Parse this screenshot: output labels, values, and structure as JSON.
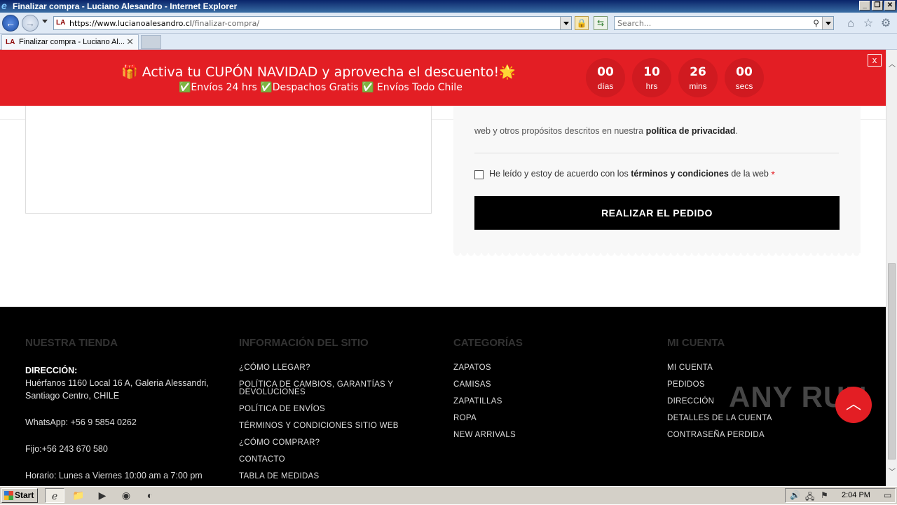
{
  "window": {
    "title": "Finalizar compra - Luciano Alesandro - Internet Explorer",
    "controls": [
      "_",
      "❐",
      "✕"
    ]
  },
  "browser": {
    "url_host": "https://www.lucianoalesandro.cl",
    "url_path": "/finalizar-compra/",
    "search_placeholder": "Search...",
    "tab_title": "Finalizar compra - Luciano Al...",
    "site_icon": "LA"
  },
  "promo": {
    "headline": "🎁 Activa tu CUPÓN NAVIDAD y aprovecha el descuento!🌟",
    "sub": "✅Envíos 24 hrs ✅Despachos Gratis ✅ Envíos Todo Chile",
    "close": "x",
    "countdown": [
      {
        "num": "00",
        "unit": "días"
      },
      {
        "num": "10",
        "unit": "hrs"
      },
      {
        "num": "26",
        "unit": "mins"
      },
      {
        "num": "00",
        "unit": "secs"
      }
    ]
  },
  "order": {
    "privacy_prefix": "web y otros propósitos descritos en nuestra ",
    "privacy_link": "política de privacidad",
    "privacy_suffix": ".",
    "terms_prefix": "He leído y estoy de acuerdo con los ",
    "terms_link": "términos y condiciones",
    "terms_suffix": " de la web",
    "required": "*",
    "place_order": "REALIZAR EL PEDIDO"
  },
  "footer": {
    "store": {
      "heading": "NUESTRA TIENDA",
      "address_label": "DIRECCIÓN:",
      "address_line1": "Huérfanos 1160 Local 16 A, Galeria Alessandri,",
      "address_line2": "Santiago Centro, CHILE",
      "whatsapp": "WhatsApp: +56 9 5854 0262",
      "phone": "Fijo:+56 243 670 580",
      "hours": "Horario: Lunes a Viernes 10:00 am a 7:00 pm"
    },
    "info": {
      "heading": "INFORMACIÓN DEL SITIO",
      "links": [
        "¿CÓMO LLEGAR?",
        "POLÍTICA DE CAMBIOS, GARANTÍAS Y DEVOLUCIONES",
        "POLÍTICA DE ENVÍOS",
        "TÉRMINOS Y CONDICIONES SITIO WEB",
        "¿CÓMO COMPRAR?",
        "CONTACTO",
        "TABLA DE MEDIDAS"
      ]
    },
    "categories": {
      "heading": "CATEGORÍAS",
      "links": [
        "ZAPATOS",
        "CAMISAS",
        "ZAPATILLAS",
        "ROPA",
        "NEW ARRIVALS"
      ]
    },
    "account": {
      "heading": "MI CUENTA",
      "links": [
        "MI CUENTA",
        "PEDIDOS",
        "DIRECCIÓN",
        "DETALLES DE LA CUENTA",
        "CONTRASEÑA PERDIDA"
      ]
    }
  },
  "watermark": "ANY RUN",
  "taskbar": {
    "start": "Start",
    "clock": "2:04 PM"
  },
  "colors": {
    "brand_red": "#e31e24",
    "footer_bg": "#000000"
  }
}
